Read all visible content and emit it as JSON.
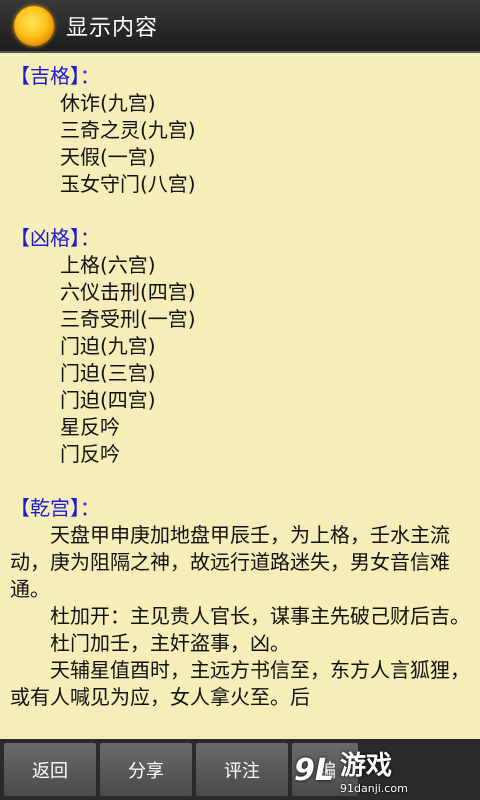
{
  "header": {
    "title": "显示内容",
    "icon": "sun-icon"
  },
  "sections": {
    "ji": {
      "heading": "【吉格】：",
      "items": [
        "休诈(九宫)",
        "三奇之灵(九宫)",
        "天假(一宫)",
        "玉女守门(八宫)"
      ]
    },
    "xiong": {
      "heading": "【凶格】：",
      "items": [
        "上格(六宫)",
        "六仪击刑(四宫)",
        "三奇受刑(一宫)",
        "门迫(九宫)",
        "门迫(三宫)",
        "门迫(四宫)",
        "星反吟",
        "门反吟"
      ]
    },
    "qian": {
      "heading": "【乾宫】：",
      "paras": [
        "天盘甲申庚加地盘甲辰壬，为上格，壬水主流动，庚为阻隔之神，故远行道路迷失，男女音信难通。",
        "杜加开：主见贵人官长，谋事主先破己财后吉。",
        "杜门加壬，主奸盗事，凶。",
        "天辅星值酉时，主远方书信至，东方人言狐狸，或有人喊见为应，女人拿火至。后"
      ]
    }
  },
  "toolbar": {
    "back": "返回",
    "share": "分享",
    "comment": "评注",
    "edit": "编"
  },
  "watermark": {
    "logo": "9L",
    "name": "游戏",
    "url": "91danji.com"
  }
}
